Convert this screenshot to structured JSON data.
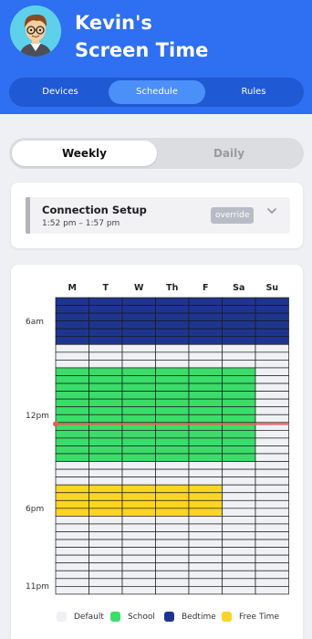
{
  "header": {
    "title_line1": "Kevin's",
    "title_line2": "Screen Time",
    "tabs": [
      {
        "label": "Devices",
        "active": false
      },
      {
        "label": "Schedule",
        "active": true
      },
      {
        "label": "Rules",
        "active": false
      }
    ]
  },
  "view_toggle": {
    "options": [
      {
        "label": "Weekly",
        "active": true
      },
      {
        "label": "Daily",
        "active": false
      }
    ]
  },
  "connection": {
    "title": "Connection Setup",
    "time": "1:52 pm – 1:57 pm",
    "badge": "override"
  },
  "schedule": {
    "days": [
      "M",
      "T",
      "W",
      "Th",
      "F",
      "Sa",
      "Su"
    ],
    "time_labels": [
      "6am",
      "12pm",
      "6pm",
      "11pm"
    ],
    "colors": {
      "default": "#f0f1f4",
      "school": "#3bdc6a",
      "bedtime": "#1e3590",
      "free_time": "#fbd523",
      "now_line": "#ee5a5a"
    },
    "blocks": [
      {
        "category": "bedtime",
        "days": [
          "M",
          "T",
          "W",
          "Th",
          "F",
          "Sa",
          "Su"
        ]
      },
      {
        "category": "school",
        "days": [
          "M",
          "T",
          "W",
          "Th",
          "F",
          "Sa"
        ]
      },
      {
        "category": "free_time",
        "days": [
          "M",
          "T",
          "W",
          "Th",
          "F"
        ]
      }
    ],
    "legend": [
      {
        "key": "default",
        "label": "Default"
      },
      {
        "key": "school",
        "label": "School"
      },
      {
        "key": "bedtime",
        "label": "Bedtime"
      },
      {
        "key": "free_time",
        "label": "Free Time"
      }
    ]
  }
}
